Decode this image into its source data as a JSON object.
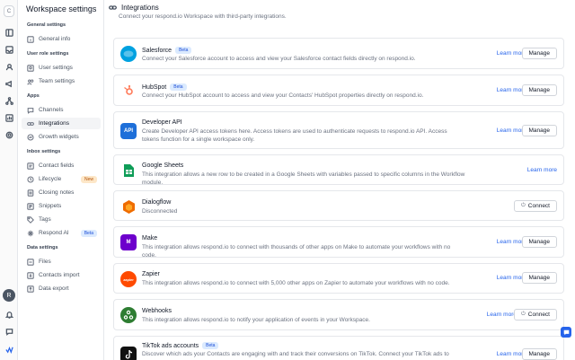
{
  "rail": {
    "workspace_initial": "C",
    "avatar_initial": "R"
  },
  "sidebar": {
    "title": "Workspace settings",
    "sections": [
      {
        "label": "General settings",
        "items": [
          {
            "label": "General info"
          }
        ]
      },
      {
        "label": "User role settings",
        "items": [
          {
            "label": "User settings"
          },
          {
            "label": "Team settings"
          }
        ]
      },
      {
        "label": "Apps",
        "items": [
          {
            "label": "Channels"
          },
          {
            "label": "Integrations"
          },
          {
            "label": "Growth widgets"
          }
        ]
      },
      {
        "label": "Inbox settings",
        "items": [
          {
            "label": "Contact fields"
          },
          {
            "label": "Lifecycle",
            "badge": "New"
          },
          {
            "label": "Closing notes"
          },
          {
            "label": "Snippets"
          },
          {
            "label": "Tags"
          },
          {
            "label": "Respond AI",
            "badge": "Beta"
          }
        ]
      },
      {
        "label": "Data settings",
        "items": [
          {
            "label": "Files"
          },
          {
            "label": "Contacts import"
          },
          {
            "label": "Data export"
          }
        ]
      }
    ]
  },
  "header": {
    "title": "Integrations",
    "subtitle": "Connect your respond.io Workspace with third-party integrations."
  },
  "integrations": [
    {
      "name": "Salesforce",
      "badge": "Beta",
      "desc": "Connect your Salesforce account to access and view your Salesforce contact fields directly on respond.io.",
      "learn": "Learn more",
      "action": "Manage",
      "color": "#00a1e0",
      "logo": "sf"
    },
    {
      "name": "HubSpot",
      "badge": "Beta",
      "desc": "Connect your HubSpot account to access and view your Contacts' HubSpot properties directly on respond.io.",
      "learn": "Learn more",
      "action": "Manage",
      "color": "#ff7a59",
      "logo": "hs"
    },
    {
      "name": "Developer API",
      "desc": "Create Developer API access tokens here. Access tokens are used to authenticate requests to respond.io API. Access tokens function for a single workspace only.",
      "learn": "Learn more",
      "action": "Manage",
      "color": "#1e6fd9",
      "logo": "API"
    },
    {
      "name": "Google Sheets",
      "desc": "This integration allows a new row to be created in a Google Sheets with variables passed to specific columns in the Workflow module.",
      "learn": "Learn more",
      "color": "#0f9d58",
      "logo": "gs"
    },
    {
      "name": "Dialogflow",
      "desc": "Disconnected",
      "action": "Connect",
      "color": "#ef6c00",
      "logo": "df"
    },
    {
      "name": "Make",
      "desc": "This integration allows respond.io to connect with thousands of other apps on Make to automate your workflows with no code.",
      "learn": "Learn more",
      "action": "Manage",
      "color": "#6d00cc",
      "logo": "M"
    },
    {
      "name": "Zapier",
      "desc": "This integration allows respond.io to connect with 5,000 other apps on Zapier to automate your workflows with no code.",
      "learn": "Learn more",
      "action": "Manage",
      "color": "#ff4a00",
      "logo": "zapier"
    },
    {
      "name": "Webhooks",
      "desc": "This integration allows respond.io to notify your application of events in your Workspace.",
      "learn": "Learn more",
      "action": "Connect",
      "color": "#2e7d32",
      "logo": "wh"
    },
    {
      "name": "TikTok ads accounts",
      "badge": "Beta",
      "desc": "Discover which ads your Contacts are engaging with and track their conversions on TikTok. Connect your TikTok ads to",
      "learn": "Learn more",
      "action": "Manage",
      "color": "#111111",
      "logo": "tt"
    }
  ]
}
